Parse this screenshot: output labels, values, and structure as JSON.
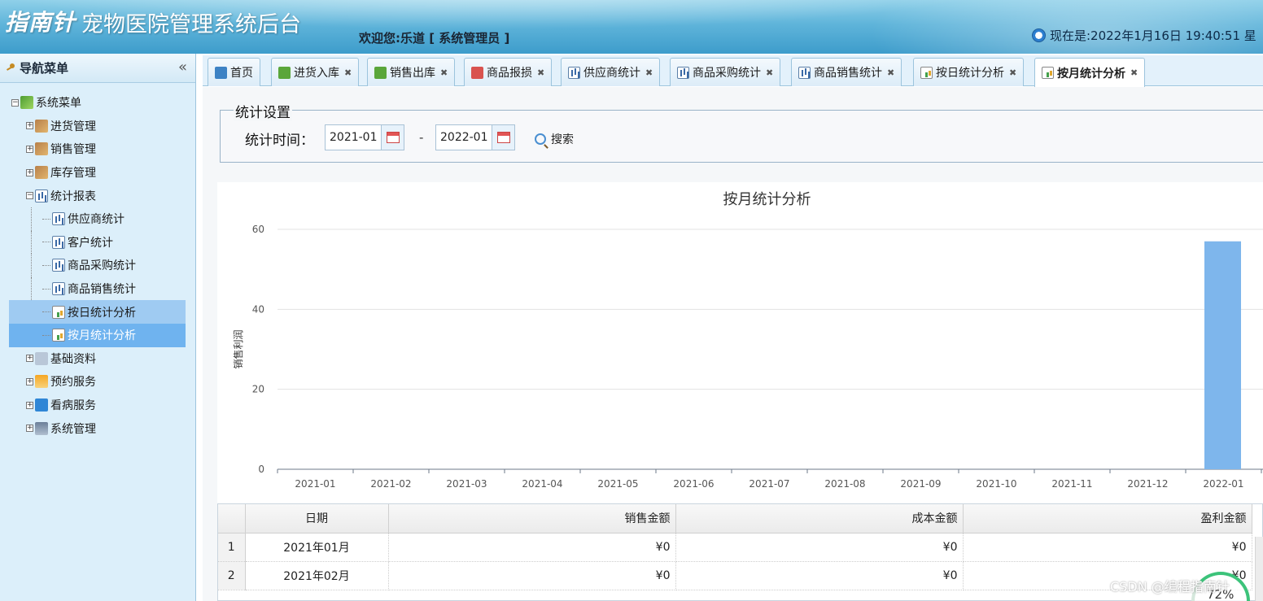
{
  "header": {
    "logo": "指南针",
    "system_title": "宠物医院管理系统后台",
    "welcome": "欢迎您:乐道 [ 系统管理员 ]",
    "clock": "现在是:2022年1月16日 19:40:51 星"
  },
  "sidebar": {
    "title": "导航菜单",
    "collapse_glyph": "«",
    "root": "系统菜单",
    "groups": [
      {
        "label": "进货管理"
      },
      {
        "label": "销售管理"
      },
      {
        "label": "库存管理"
      },
      {
        "label": "统计报表"
      }
    ],
    "report_items": [
      {
        "label": "供应商统计"
      },
      {
        "label": "客户统计"
      },
      {
        "label": "商品采购统计"
      },
      {
        "label": "商品销售统计"
      },
      {
        "label": "按日统计分析"
      },
      {
        "label": "按月统计分析"
      }
    ],
    "more_groups": [
      {
        "label": "基础资料"
      },
      {
        "label": "预约服务"
      },
      {
        "label": "看病服务"
      },
      {
        "label": "系统管理"
      }
    ]
  },
  "tabs": [
    {
      "label": "首页"
    },
    {
      "label": "进货入库"
    },
    {
      "label": "销售出库"
    },
    {
      "label": "商品报损"
    },
    {
      "label": "供应商统计"
    },
    {
      "label": "商品采购统计"
    },
    {
      "label": "商品销售统计"
    },
    {
      "label": "按日统计分析"
    },
    {
      "label": "按月统计分析"
    }
  ],
  "settings": {
    "legend": "统计设置",
    "time_label": "统计时间：",
    "start": "2021-01",
    "dash": "-",
    "end": "2022-01",
    "search": "搜索"
  },
  "chart_data": {
    "type": "bar",
    "title": "按月统计分析",
    "ylabel": "销售利润",
    "xlabel": "",
    "categories": [
      "2021-01",
      "2021-02",
      "2021-03",
      "2021-04",
      "2021-05",
      "2021-06",
      "2021-07",
      "2021-08",
      "2021-09",
      "2021-10",
      "2021-11",
      "2021-12",
      "2022-01"
    ],
    "values": [
      0,
      0,
      0,
      0,
      0,
      0,
      0,
      0,
      0,
      0,
      0,
      0,
      57
    ],
    "ylim": [
      0,
      60
    ],
    "yticks": [
      0,
      20,
      40,
      60
    ],
    "grid": true,
    "bar_color": "#7eb6ec"
  },
  "table": {
    "headers": [
      "日期",
      "销售金额",
      "成本金额",
      "盈利金额"
    ],
    "rows": [
      {
        "n": "1",
        "date": "2021年01月",
        "sale": "¥0",
        "cost": "¥0",
        "profit": "¥0"
      },
      {
        "n": "2",
        "date": "2021年02月",
        "sale": "¥0",
        "cost": "¥0",
        "profit": "¥0"
      }
    ]
  },
  "overlay": {
    "watermark": "CSDN @编程指南针",
    "progress": "72%"
  }
}
